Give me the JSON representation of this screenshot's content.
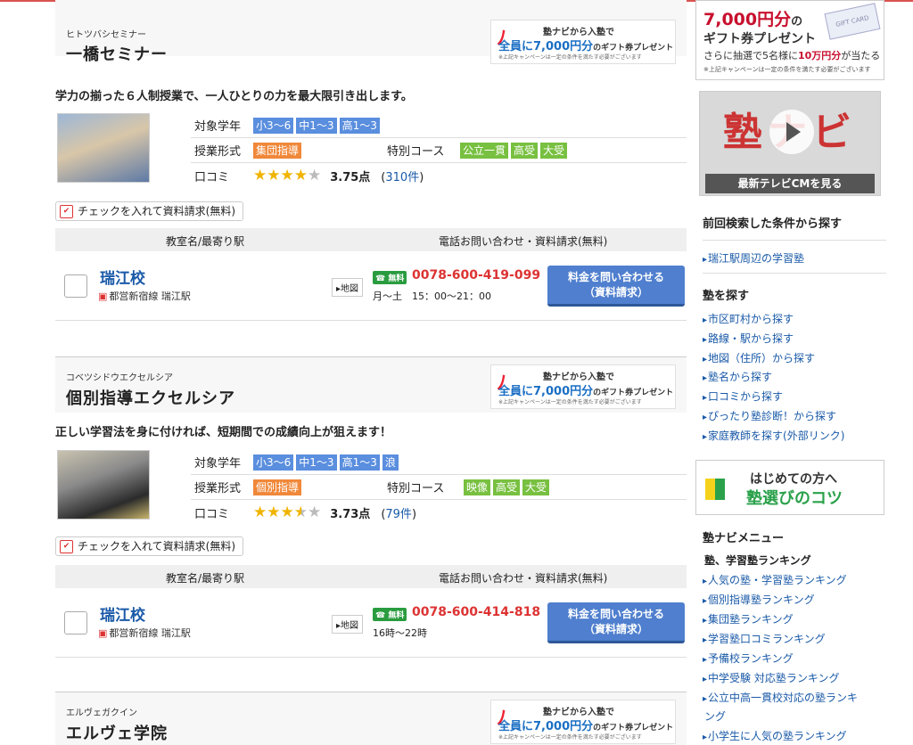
{
  "schools": [
    {
      "kana": "ヒトツバシセミナー",
      "name": "一橋セミナー",
      "catch": "学力の揃った６人制授業で、一人ひとりの力を最大限引き出します。",
      "grade_label": "対象学年",
      "grades": [
        "小3〜6",
        "中1〜3",
        "高1〜3"
      ],
      "format_label": "授業形式",
      "format": "集団指導",
      "course_label": "特別コース",
      "courses": [
        "公立一貫",
        "高受",
        "大受"
      ],
      "review_label": "口コミ",
      "rating": 3.75,
      "stars": "★★★★",
      "stars_off": "★",
      "score": "3.75点",
      "count": "310件",
      "check_label": "チェックを入れて資料請求(無料)",
      "th_room": "教室名/最寄り駅",
      "th_contact": "電話お問い合わせ・資料請求(無料)",
      "room": "瑞江校",
      "station": "都営新宿線 瑞江駅",
      "map": "地図",
      "free": "☎ 無料",
      "tel": "0078-600-419-099",
      "hours": "月〜土　15：00〜21：00",
      "inquiry_line1": "料金を問い合わせる",
      "inquiry_line2": "（資料請求）"
    },
    {
      "kana": "コベツシドウエクセルシア",
      "name": "個別指導エクセルシア",
      "catch": "正しい学習法を身に付ければ、短期間での成績向上が狙えます！",
      "grade_label": "対象学年",
      "grades": [
        "小3〜6",
        "中1〜3",
        "高1〜3",
        "浪"
      ],
      "format_label": "授業形式",
      "format": "個別指導",
      "course_label": "特別コース",
      "courses": [
        "映像",
        "高受",
        "大受"
      ],
      "review_label": "口コミ",
      "rating": 3.73,
      "stars": "★★★",
      "stars_half": "★",
      "stars_off": "★",
      "score": "3.73点",
      "count": "79件",
      "check_label": "チェックを入れて資料請求(無料)",
      "th_room": "教室名/最寄り駅",
      "th_contact": "電話お問い合わせ・資料請求(無料)",
      "room": "瑞江校",
      "station": "都営新宿線 瑞江駅",
      "map": "地図",
      "free": "☎ 無料",
      "tel": "0078-600-414-818",
      "hours": "16時〜22時",
      "inquiry_line1": "料金を問い合わせる",
      "inquiry_line2": "（資料請求）"
    },
    {
      "kana": "エルヴェガクイン",
      "name": "エルヴェ学院"
    }
  ],
  "banner": {
    "line1": "塾ナビから入塾で",
    "line2_main": "全員に7,000円分",
    "line2_small": "のギフト券プレゼント",
    "note": "※上記キャンペーンは一定の条件を満たす必要がございます"
  },
  "sidebar": {
    "gift_amount": "7,000円分",
    "gift_no": "の",
    "gift_line2": "ギフト券プレゼント",
    "gift_line3a": "さらに抽選で5名様に",
    "gift_line3b": "10万円分",
    "gift_line3c": "が当たる",
    "gift_note": "※上記キャンペーンは一定の条件を満たす必要がございます",
    "gift_card_text": "GIFT CARD",
    "cm_logo": "塾ナビ",
    "cm_button": "最新テレビCMを見る",
    "prev_title": "前回検索した条件から探す",
    "prev_link": "瑞江駅周辺の学習塾",
    "find_title": "塾を探す",
    "find_links": [
      "市区町村から探す",
      "路線・駅から探す",
      "地図（住所）から探す",
      "塾名から探す",
      "口コミから探す",
      "ぴったり塾診断！から探す",
      "家庭教師を探す(外部リンク)"
    ],
    "beginner_line1": "はじめての方へ",
    "beginner_line2": "塾選びのコツ",
    "menu_title": "塾ナビメニュー",
    "ranking_title": "塾、学習塾ランキング",
    "ranking_links": [
      "人気の塾・学習塾ランキング",
      "個別指導塾ランキング",
      "集団塾ランキング",
      "学習塾口コミランキング",
      "予備校ランキング",
      "中学受験 対応塾ランキング",
      "公立中高一貫校対応の塾ランキ",
      "ング",
      "小学生に人気の塾ランキング"
    ]
  }
}
